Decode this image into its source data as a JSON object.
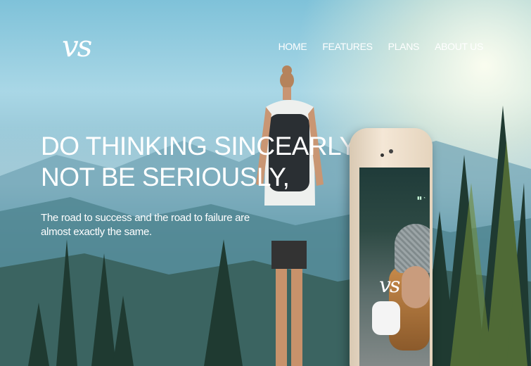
{
  "brand": {
    "logo_text": "vs"
  },
  "nav": {
    "items": [
      {
        "label": "HOME"
      },
      {
        "label": "FEATURES"
      },
      {
        "label": "PLANS"
      },
      {
        "label": "ABOUT US"
      }
    ]
  },
  "hero": {
    "headline_line1": "DO THINKING SINCEARLY,",
    "headline_line2": "NOT BE SERIOUSLY,",
    "subtext": "The road to success and the road to failure are almost exactly the same."
  },
  "phone": {
    "screen_logo": "vs"
  },
  "colors": {
    "text": "#ffffff",
    "sky": "#a9d7e6",
    "forest": "#2e4b44"
  }
}
